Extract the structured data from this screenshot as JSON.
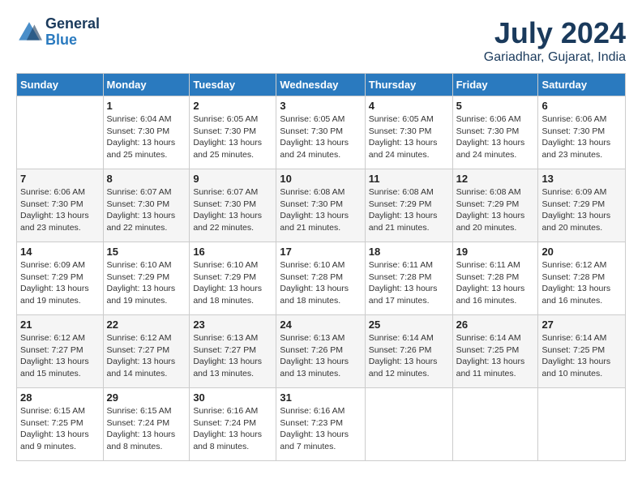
{
  "logo": {
    "line1": "General",
    "line2": "Blue"
  },
  "title": "July 2024",
  "location": "Gariadhar, Gujarat, India",
  "days_header": [
    "Sunday",
    "Monday",
    "Tuesday",
    "Wednesday",
    "Thursday",
    "Friday",
    "Saturday"
  ],
  "weeks": [
    [
      {
        "num": "",
        "detail": ""
      },
      {
        "num": "1",
        "detail": "Sunrise: 6:04 AM\nSunset: 7:30 PM\nDaylight: 13 hours\nand 25 minutes."
      },
      {
        "num": "2",
        "detail": "Sunrise: 6:05 AM\nSunset: 7:30 PM\nDaylight: 13 hours\nand 25 minutes."
      },
      {
        "num": "3",
        "detail": "Sunrise: 6:05 AM\nSunset: 7:30 PM\nDaylight: 13 hours\nand 24 minutes."
      },
      {
        "num": "4",
        "detail": "Sunrise: 6:05 AM\nSunset: 7:30 PM\nDaylight: 13 hours\nand 24 minutes."
      },
      {
        "num": "5",
        "detail": "Sunrise: 6:06 AM\nSunset: 7:30 PM\nDaylight: 13 hours\nand 24 minutes."
      },
      {
        "num": "6",
        "detail": "Sunrise: 6:06 AM\nSunset: 7:30 PM\nDaylight: 13 hours\nand 23 minutes."
      }
    ],
    [
      {
        "num": "7",
        "detail": "Sunrise: 6:06 AM\nSunset: 7:30 PM\nDaylight: 13 hours\nand 23 minutes."
      },
      {
        "num": "8",
        "detail": "Sunrise: 6:07 AM\nSunset: 7:30 PM\nDaylight: 13 hours\nand 22 minutes."
      },
      {
        "num": "9",
        "detail": "Sunrise: 6:07 AM\nSunset: 7:30 PM\nDaylight: 13 hours\nand 22 minutes."
      },
      {
        "num": "10",
        "detail": "Sunrise: 6:08 AM\nSunset: 7:30 PM\nDaylight: 13 hours\nand 21 minutes."
      },
      {
        "num": "11",
        "detail": "Sunrise: 6:08 AM\nSunset: 7:29 PM\nDaylight: 13 hours\nand 21 minutes."
      },
      {
        "num": "12",
        "detail": "Sunrise: 6:08 AM\nSunset: 7:29 PM\nDaylight: 13 hours\nand 20 minutes."
      },
      {
        "num": "13",
        "detail": "Sunrise: 6:09 AM\nSunset: 7:29 PM\nDaylight: 13 hours\nand 20 minutes."
      }
    ],
    [
      {
        "num": "14",
        "detail": "Sunrise: 6:09 AM\nSunset: 7:29 PM\nDaylight: 13 hours\nand 19 minutes."
      },
      {
        "num": "15",
        "detail": "Sunrise: 6:10 AM\nSunset: 7:29 PM\nDaylight: 13 hours\nand 19 minutes."
      },
      {
        "num": "16",
        "detail": "Sunrise: 6:10 AM\nSunset: 7:29 PM\nDaylight: 13 hours\nand 18 minutes."
      },
      {
        "num": "17",
        "detail": "Sunrise: 6:10 AM\nSunset: 7:28 PM\nDaylight: 13 hours\nand 18 minutes."
      },
      {
        "num": "18",
        "detail": "Sunrise: 6:11 AM\nSunset: 7:28 PM\nDaylight: 13 hours\nand 17 minutes."
      },
      {
        "num": "19",
        "detail": "Sunrise: 6:11 AM\nSunset: 7:28 PM\nDaylight: 13 hours\nand 16 minutes."
      },
      {
        "num": "20",
        "detail": "Sunrise: 6:12 AM\nSunset: 7:28 PM\nDaylight: 13 hours\nand 16 minutes."
      }
    ],
    [
      {
        "num": "21",
        "detail": "Sunrise: 6:12 AM\nSunset: 7:27 PM\nDaylight: 13 hours\nand 15 minutes."
      },
      {
        "num": "22",
        "detail": "Sunrise: 6:12 AM\nSunset: 7:27 PM\nDaylight: 13 hours\nand 14 minutes."
      },
      {
        "num": "23",
        "detail": "Sunrise: 6:13 AM\nSunset: 7:27 PM\nDaylight: 13 hours\nand 13 minutes."
      },
      {
        "num": "24",
        "detail": "Sunrise: 6:13 AM\nSunset: 7:26 PM\nDaylight: 13 hours\nand 13 minutes."
      },
      {
        "num": "25",
        "detail": "Sunrise: 6:14 AM\nSunset: 7:26 PM\nDaylight: 13 hours\nand 12 minutes."
      },
      {
        "num": "26",
        "detail": "Sunrise: 6:14 AM\nSunset: 7:25 PM\nDaylight: 13 hours\nand 11 minutes."
      },
      {
        "num": "27",
        "detail": "Sunrise: 6:14 AM\nSunset: 7:25 PM\nDaylight: 13 hours\nand 10 minutes."
      }
    ],
    [
      {
        "num": "28",
        "detail": "Sunrise: 6:15 AM\nSunset: 7:25 PM\nDaylight: 13 hours\nand 9 minutes."
      },
      {
        "num": "29",
        "detail": "Sunrise: 6:15 AM\nSunset: 7:24 PM\nDaylight: 13 hours\nand 8 minutes."
      },
      {
        "num": "30",
        "detail": "Sunrise: 6:16 AM\nSunset: 7:24 PM\nDaylight: 13 hours\nand 8 minutes."
      },
      {
        "num": "31",
        "detail": "Sunrise: 6:16 AM\nSunset: 7:23 PM\nDaylight: 13 hours\nand 7 minutes."
      },
      {
        "num": "",
        "detail": ""
      },
      {
        "num": "",
        "detail": ""
      },
      {
        "num": "",
        "detail": ""
      }
    ]
  ]
}
